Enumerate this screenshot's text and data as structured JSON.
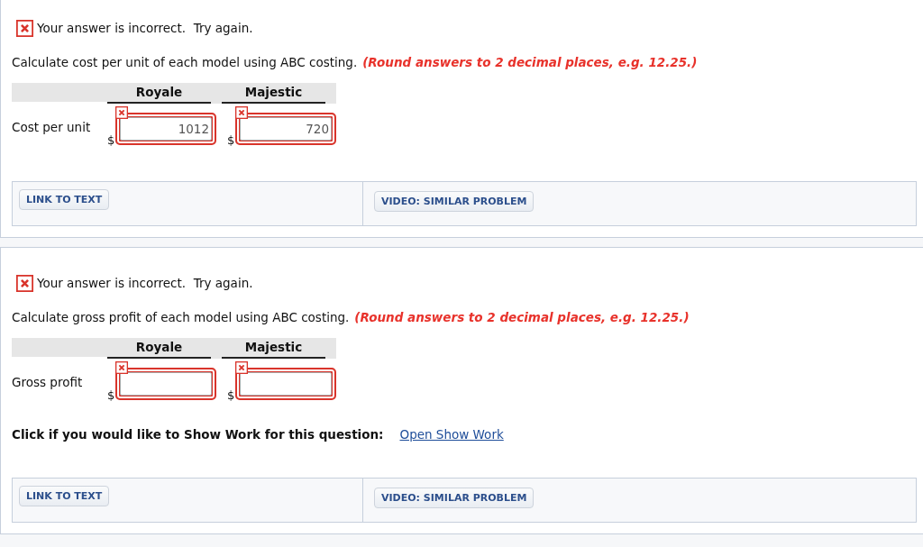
{
  "questions": [
    {
      "feedback": {
        "incorrect": true,
        "text": "Your answer is incorrect.  Try again."
      },
      "instruction": "Calculate cost per unit of each model using ABC costing.",
      "hint": "(Round answers to 2 decimal places, e.g. 12.25.)",
      "table": {
        "columns": [
          "Royale",
          "Majestic"
        ],
        "rows": [
          {
            "label": "Cost per unit",
            "fields": [
              {
                "prefix": "$",
                "value": "1012",
                "incorrect": true
              },
              {
                "prefix": "$",
                "value": "720",
                "incorrect": true
              }
            ]
          }
        ]
      },
      "footer": {
        "buttons": [
          "LINK TO TEXT",
          "VIDEO: SIMILAR PROBLEM"
        ]
      }
    },
    {
      "feedback": {
        "incorrect": true,
        "text": "Your answer is incorrect.  Try again."
      },
      "instruction": "Calculate gross profit of each model using ABC costing.",
      "hint": "(Round answers to 2 decimal places, e.g. 12.25.)",
      "table": {
        "columns": [
          "Royale",
          "Majestic"
        ],
        "rows": [
          {
            "label": "Gross profit",
            "fields": [
              {
                "prefix": "$",
                "incorrect": true
              },
              {
                "prefix": "$",
                "incorrect": true
              }
            ]
          }
        ]
      },
      "show_work": {
        "prompt": "Click if you would like to Show Work for this question:",
        "link": "Open Show Work"
      },
      "footer": {
        "buttons": [
          "LINK TO TEXT",
          "VIDEO: SIMILAR PROBLEM"
        ]
      }
    }
  ]
}
